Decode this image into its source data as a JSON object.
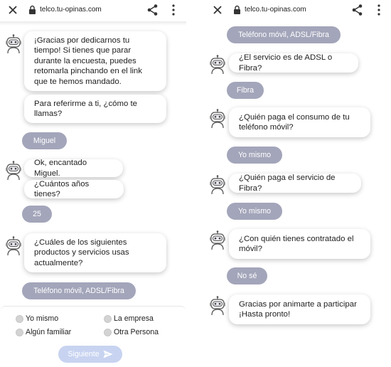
{
  "browser": {
    "url": "telco.tu-opinas.com",
    "close_icon": "close-icon",
    "lock_icon": "lock-icon",
    "share_icon": "share-icon",
    "menu_icon": "more-vertical-icon"
  },
  "colors": {
    "user_bubble": "#a3a5ba",
    "bot_bubble": "#ffffff",
    "submit_button": "#c7d3f0"
  },
  "left_chat": {
    "bot_1": "¡Gracias por dedicarnos tu tiempo! Si tienes que parar durante la encuesta, puedes retomarla pinchando en el link que te hemos mandado.",
    "bot_2": "Para referirme a ti, ¿cómo te llamas?",
    "user_1": "Miguel",
    "bot_3": "Ok, encantado Miguel.",
    "bot_4": "¿Cuántos años tienes?",
    "user_2": "25",
    "bot_5": "¿Cuáles de los siguientes productos y servicios usas actualmente?",
    "user_3": "Teléfono móvil, ADSL/Fibra"
  },
  "options": [
    {
      "label": "Yo mismo"
    },
    {
      "label": "La empresa"
    },
    {
      "label": "Algún familiar"
    },
    {
      "label": "Otra Persona"
    }
  ],
  "submit": {
    "label": "Siguiente",
    "icon": "send-icon"
  },
  "right_chat": {
    "user_0": "Teléfono móvil, ADSL/Fibra",
    "bot_1": "¿El servicio es de ADSL o Fibra?",
    "user_1": "Fibra",
    "bot_2": "¿Quién paga el consumo de tu teléfono móvil?",
    "user_2": "Yo mismo",
    "bot_3": "¿Quién paga el servicio de Fibra?",
    "user_3": "Yo mismo",
    "bot_4": "¿Con quién tienes contratado el móvil?",
    "user_4": "No sé",
    "bot_5": "Gracias por animarte a participar ¡Hasta pronto!"
  }
}
